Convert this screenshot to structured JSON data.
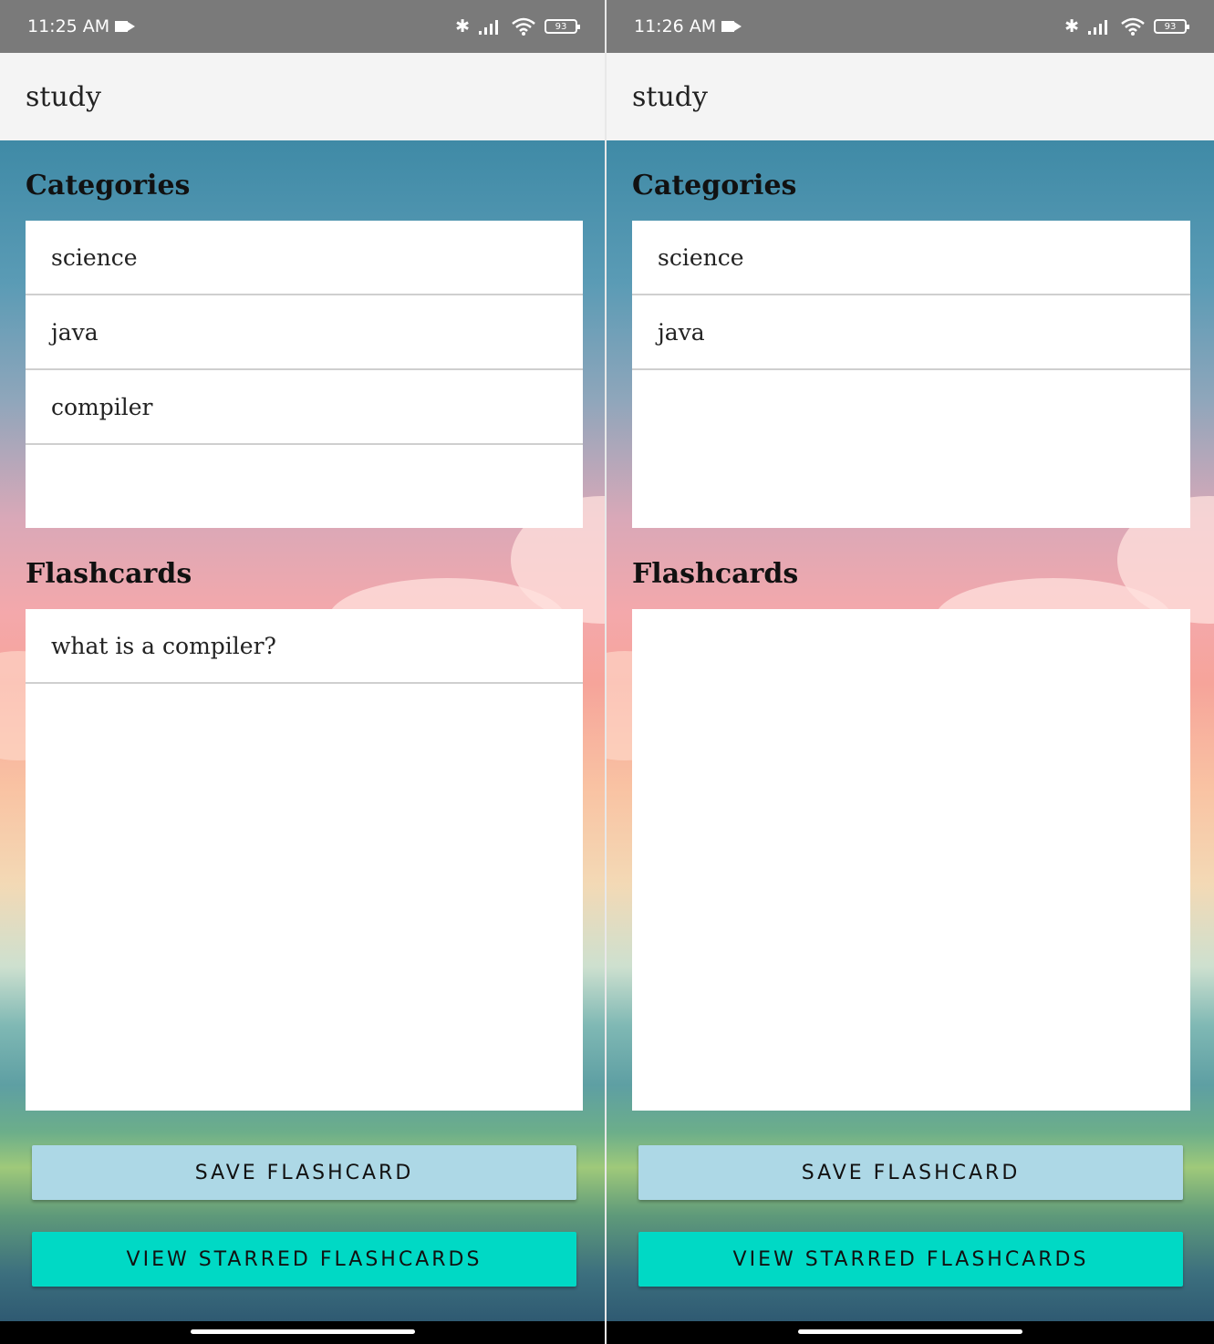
{
  "screens": [
    {
      "status": {
        "time": "11:25",
        "ampm": "AM",
        "battery": "93"
      },
      "app_title": "study",
      "categories_title": "Categories",
      "categories": [
        "science",
        "java",
        "compiler"
      ],
      "flashcards_title": "Flashcards",
      "flashcards": [
        "what is a compiler?"
      ],
      "save_label": "SAVE FLASHCARD",
      "starred_label": "VIEW STARRED FLASHCARDS"
    },
    {
      "status": {
        "time": "11:26",
        "ampm": "AM",
        "battery": "93"
      },
      "app_title": "study",
      "categories_title": "Categories",
      "categories": [
        "science",
        "java"
      ],
      "flashcards_title": "Flashcards",
      "flashcards": [],
      "save_label": "SAVE FLASHCARD",
      "starred_label": "VIEW STARRED FLASHCARDS"
    }
  ],
  "icons": [
    "bluetooth-icon",
    "signal-icon",
    "wifi-icon",
    "battery-icon",
    "video-camera-icon"
  ],
  "colors": {
    "save_button": "#add8e6",
    "starred_button": "#00d9c5",
    "status_bar": "#7a7a7a",
    "app_bar": "#f4f4f4"
  }
}
